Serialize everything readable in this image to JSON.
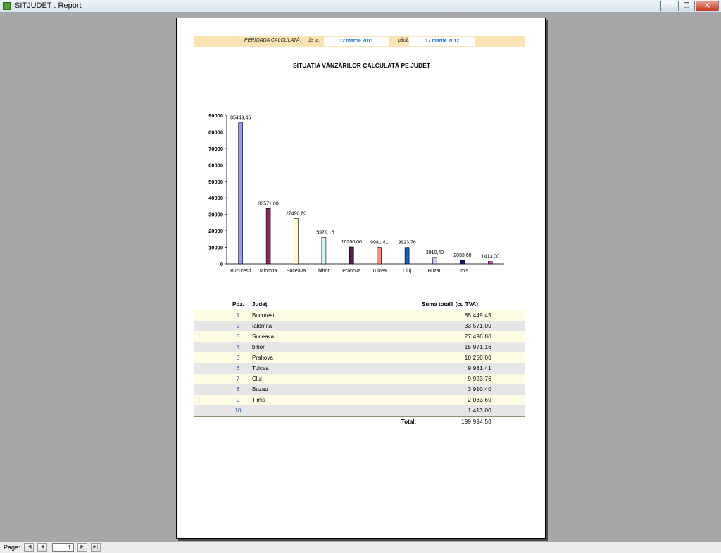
{
  "window": {
    "title": "SITJUDET : Report"
  },
  "controls": {
    "minimize": "–",
    "restore": "❐",
    "close": "✕"
  },
  "period": {
    "label": "PERIOADA CALCULATĂ:",
    "from_label": "de la:",
    "from_value": "12 martie 2011",
    "to_label": "până la:",
    "to_value": "17 martie 2012"
  },
  "report": {
    "title": "SITUAȚIA VÂNZĂRILOR CALCULATĂ PE JUDEȚ"
  },
  "chart_data": {
    "type": "bar",
    "title": "",
    "xlabel": "",
    "ylabel": "",
    "ylim": [
      0,
      90000
    ],
    "yticks": [
      0,
      10000,
      20000,
      30000,
      40000,
      50000,
      60000,
      70000,
      80000,
      90000
    ],
    "categories": [
      "Bucuresti",
      "Ialomita",
      "Suceava",
      "bihor",
      "Prahova",
      "Tulcea",
      "Cluj",
      "Buzau",
      "Timis",
      ""
    ],
    "values": [
      85449.45,
      33571.0,
      27490.8,
      15971.16,
      10250.0,
      9981.41,
      9923.76,
      3910.4,
      2033.6,
      1413.0
    ],
    "value_labels": [
      "85449,45",
      "33571,00",
      "27490,80",
      "15971,16",
      "10250,00",
      "9981,41",
      "9923,76",
      "3910,40",
      "2033,60",
      "1413,00"
    ],
    "colors": [
      "#9a9aef",
      "#8a2a56",
      "#fffccc",
      "#d4f2f7",
      "#5c1a5a",
      "#f78f83",
      "#1060c8",
      "#c7c7f0",
      "#1a1a7a",
      "#d03cd0"
    ],
    "grid": false,
    "legend": "none"
  },
  "table": {
    "headers": {
      "poz": "Poz.",
      "judet": "Județ",
      "suma": "Suma totală (cu TVA)"
    },
    "rows": [
      {
        "poz": "1",
        "judet": "Bucuresti",
        "suma": "85.449,45"
      },
      {
        "poz": "2",
        "judet": "Ialomita",
        "suma": "33.571,00"
      },
      {
        "poz": "3",
        "judet": "Suceava",
        "suma": "27.490,80"
      },
      {
        "poz": "4",
        "judet": "bihor",
        "suma": "15.971,16"
      },
      {
        "poz": "5",
        "judet": "Prahova",
        "suma": "10.250,00"
      },
      {
        "poz": "6",
        "judet": "Tulcea",
        "suma": "9.981,41"
      },
      {
        "poz": "7",
        "judet": "Cluj",
        "suma": "9.923,76"
      },
      {
        "poz": "8",
        "judet": "Buzau",
        "suma": "3.910,40"
      },
      {
        "poz": "9",
        "judet": "Timis",
        "suma": "2.033,60"
      },
      {
        "poz": "10",
        "judet": "",
        "suma": "1.413,00"
      }
    ],
    "total_label": "Total:",
    "total_value": "199.994,58"
  },
  "statusbar": {
    "page_label": "Page:",
    "page_value": "1",
    "nav": {
      "first": "|◀",
      "prev": "◀",
      "next": "▶",
      "last": "▶|"
    }
  }
}
